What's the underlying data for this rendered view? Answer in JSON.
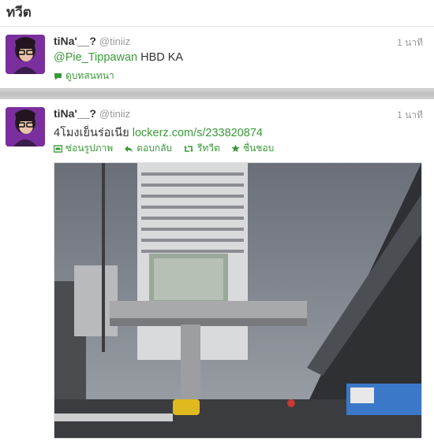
{
  "header": {
    "title": "ทวีต"
  },
  "tweets": [
    {
      "fullname": "tiNa'__?",
      "username": "@tiniiz",
      "time": "1 นาที",
      "mention": "@Pie_Tippawan",
      "text_after": " HBD KA",
      "actions": {
        "conversation": "ดูบทสนทนา"
      }
    },
    {
      "fullname": "tiNa'__?",
      "username": "@tiniiz",
      "time": "1 นาที",
      "text_before": "4โมงเย็นร่อเนีย ",
      "link": "lockerz.com/s/233820874",
      "actions": {
        "hide_media": "ซ่อนรูปภาพ",
        "reply": "ตอบกลับ",
        "retweet": "รีทวีต",
        "favorite": "ชื่นชอบ"
      }
    }
  ],
  "colors": {
    "link_green": "#3a9a3a",
    "muted": "#999999"
  },
  "icons": [
    "speech-bubble-icon",
    "image-icon",
    "reply-arrow-icon",
    "retweet-icon",
    "star-icon"
  ]
}
